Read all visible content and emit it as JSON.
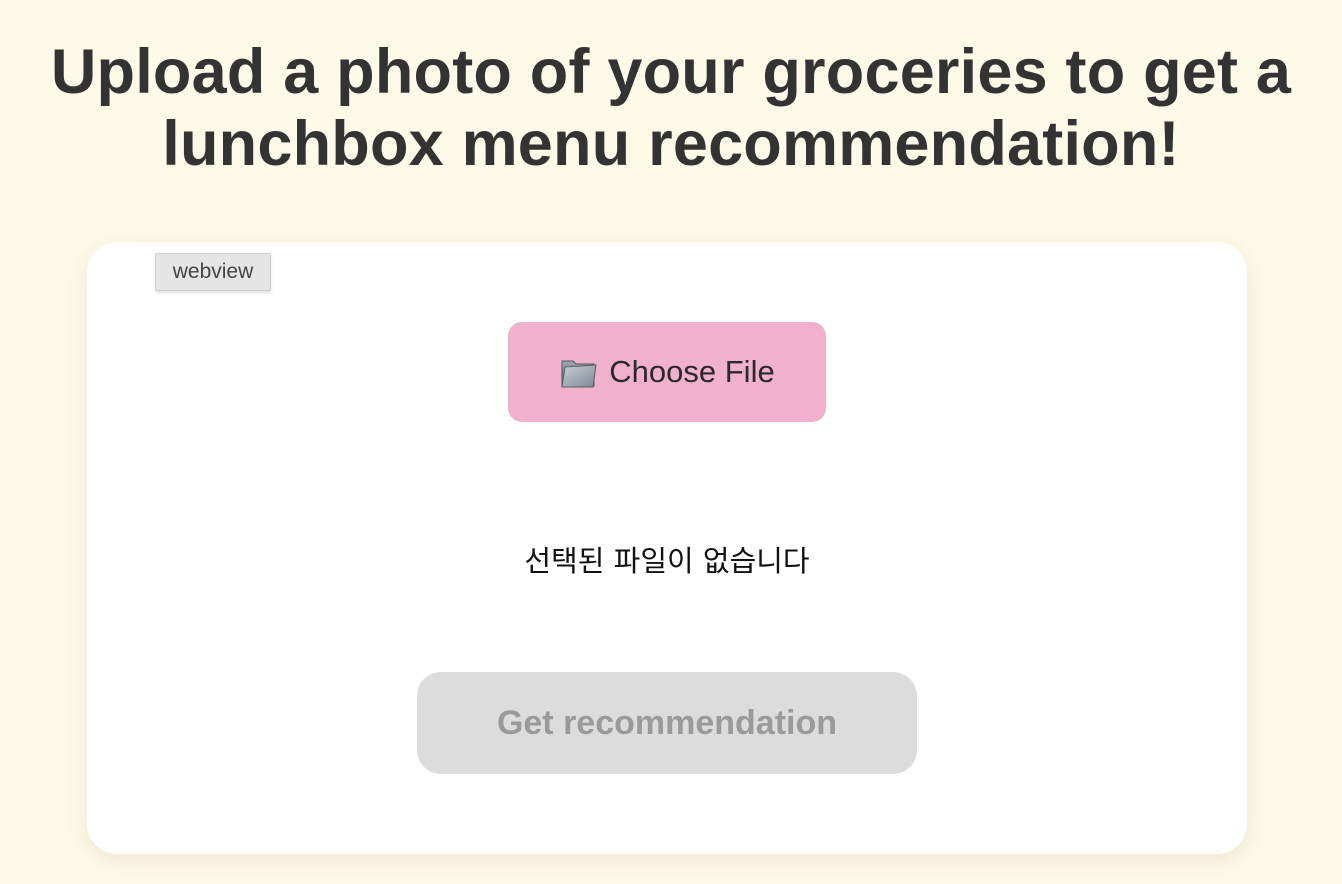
{
  "header": {
    "title": "Upload a photo of your groceries to get a lunchbox menu recommendation!"
  },
  "card": {
    "badge": "webview",
    "choose_file": {
      "icon": "folder-icon",
      "label": "Choose File"
    },
    "file_status": "선택된 파일이 없습니다",
    "submit": {
      "label": "Get recommendation",
      "state": "disabled"
    }
  },
  "colors": {
    "background": "#fdfae8",
    "card": "#ffffff",
    "choose_file_button": "#f1b1cc",
    "disabled_button": "#dcdcdc",
    "disabled_text": "#9a9a9a",
    "title_text": "#333333"
  }
}
